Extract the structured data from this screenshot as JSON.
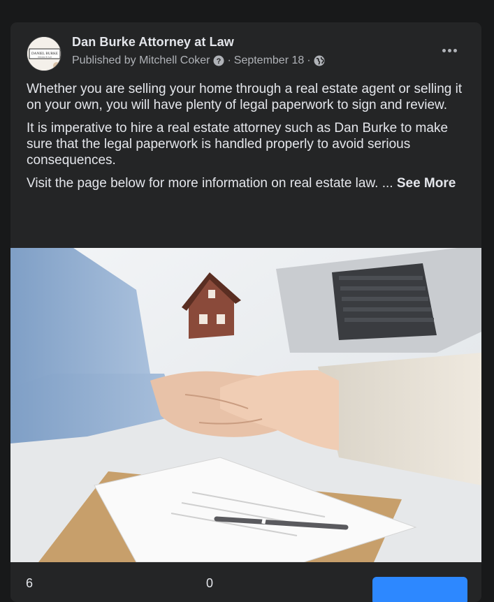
{
  "post": {
    "page_name": "Dan Burke Attorney at Law",
    "published_prefix": "Published by",
    "publisher": "Mitchell Coker",
    "date": "September 18",
    "separator": "·",
    "avatar_logo_text": "DANIEL BURKE",
    "avatar_logo_subtext": "Attorney At Law",
    "more_icon": "more-horizontal-icon",
    "paragraphs": [
      "Whether you are selling your home through a real estate agent or selling it on your own, you will have plenty of legal paperwork to sign and review.",
      "It is imperative to hire a real estate attorney such as Dan Burke to make sure that the legal paperwork is handled properly to avoid serious consequences.",
      "Visit the page below for more information on real estate law. ..."
    ],
    "see_more": "See More",
    "image_icon": "handshake-photo"
  },
  "stats": {
    "first_count": "6",
    "second_count": "0"
  },
  "colors": {
    "background": "#18191a",
    "card": "#242526",
    "primary_text": "#e4e6eb",
    "secondary_text": "#b0b3b8",
    "button_blue": "#2d88ff"
  }
}
